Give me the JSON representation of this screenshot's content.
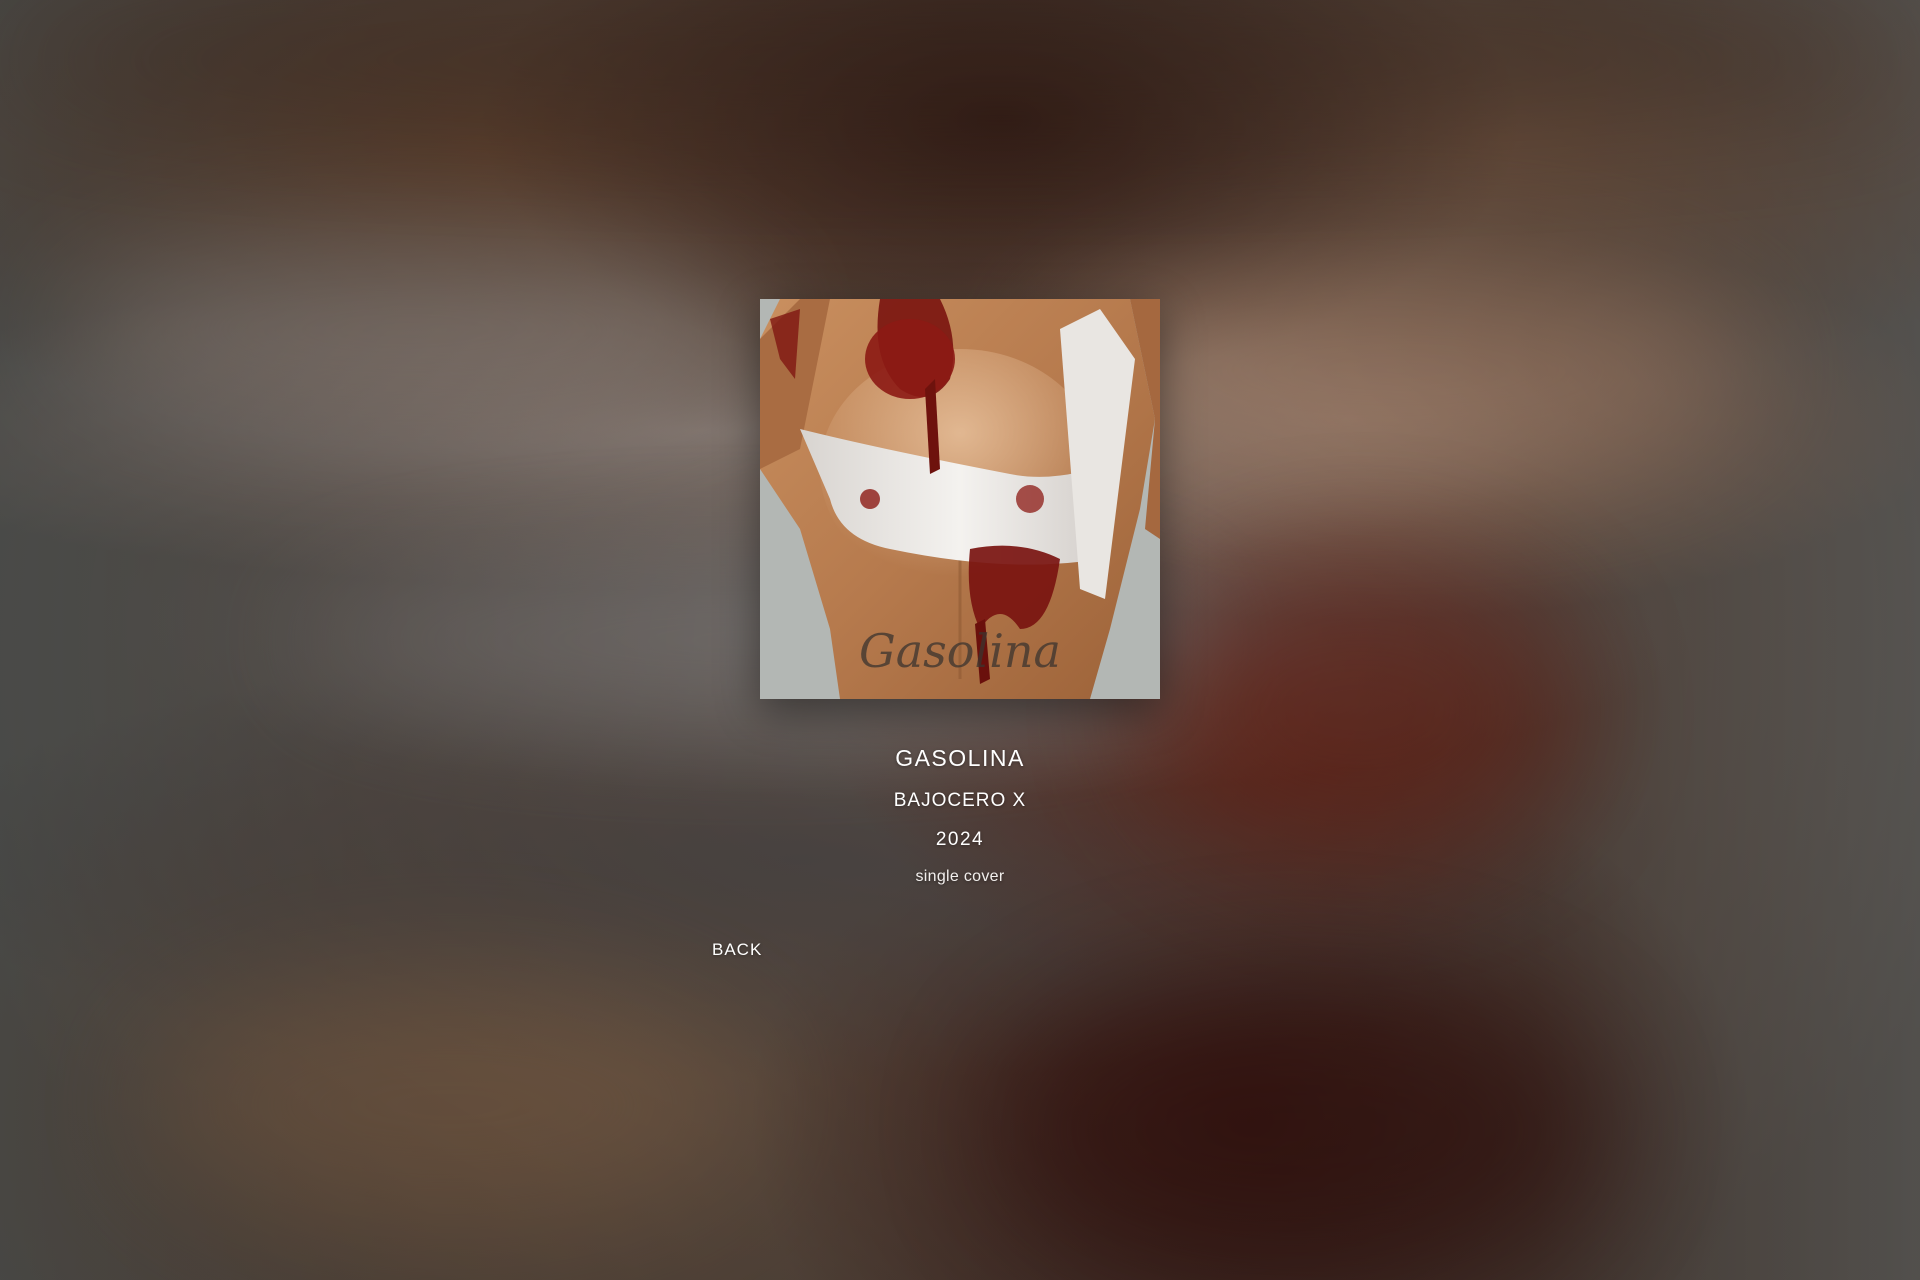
{
  "release": {
    "title": "GASOLINA",
    "artist": "BAJOCERO X",
    "year": "2024",
    "type": "single cover",
    "cover_alt": "Gasolina single cover artwork",
    "cover_tattoo_text": "Gasolina"
  },
  "navigation": {
    "back_label": "BACK"
  },
  "colors": {
    "text": "#ffffff",
    "background": "#4a4542",
    "cover_backdrop": "#b3b7b4",
    "blood": "#7a1410"
  }
}
